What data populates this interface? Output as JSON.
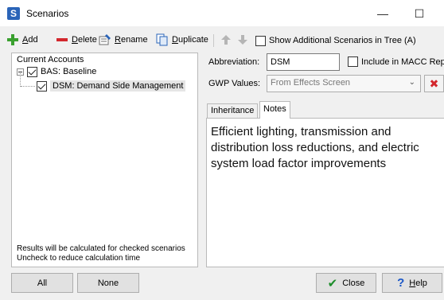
{
  "window": {
    "title": "Scenarios",
    "app_icon_letter": "S",
    "minimize_glyph": "—",
    "maximize_glyph": "☐",
    "close_glyph": "✕"
  },
  "toolbar": {
    "add": {
      "prefix": "",
      "ul": "A",
      "rest": "dd"
    },
    "delete": {
      "prefix": "",
      "ul": "D",
      "rest": "elete"
    },
    "rename": {
      "prefix": "",
      "ul": "R",
      "rest": "ename"
    },
    "duplicate": {
      "prefix": "",
      "ul": "D",
      "rest": "uplicate"
    },
    "show_additional": "Show Additional Scenarios in Tree (A)",
    "show_additional_checked": false
  },
  "tree": {
    "header": "Current Accounts",
    "items": [
      {
        "label": "BAS: Baseline",
        "checked": true
      },
      {
        "label": "DSM: Demand Side Management",
        "checked": true
      }
    ],
    "note_line1": "Results will be calculated for checked scenarios",
    "note_line2": "Uncheck to reduce calculation time"
  },
  "details": {
    "abbreviation_label": "Abbreviation:",
    "abbreviation_value": "DSM",
    "macc_label": "Include in MACC Rep",
    "macc_checked": false,
    "gwp_label": "GWP Values:",
    "gwp_value": "From Effects Screen",
    "tabs": [
      {
        "label": "Inheritance"
      },
      {
        "label": "Notes"
      }
    ],
    "notes_text": "Efficient lighting, transmission and distribution loss reductions, and electric system load factor improvements"
  },
  "buttons": {
    "all": "All",
    "none": "None",
    "close": "Close",
    "help_ul": "H",
    "help_rest": "elp"
  },
  "icons": {
    "add": "plus-icon",
    "delete": "minus-icon",
    "rename": "rename-icon",
    "duplicate": "duplicate-icon",
    "up": "arrow-up-icon",
    "down": "arrow-down-icon",
    "close_check": "checkmark-icon",
    "help": "question-icon",
    "clear": "red-x-icon"
  },
  "colors": {
    "accent_green": "#3aa02f",
    "delete_red": "#d3272d",
    "app_icon_blue": "#2a64b8"
  }
}
